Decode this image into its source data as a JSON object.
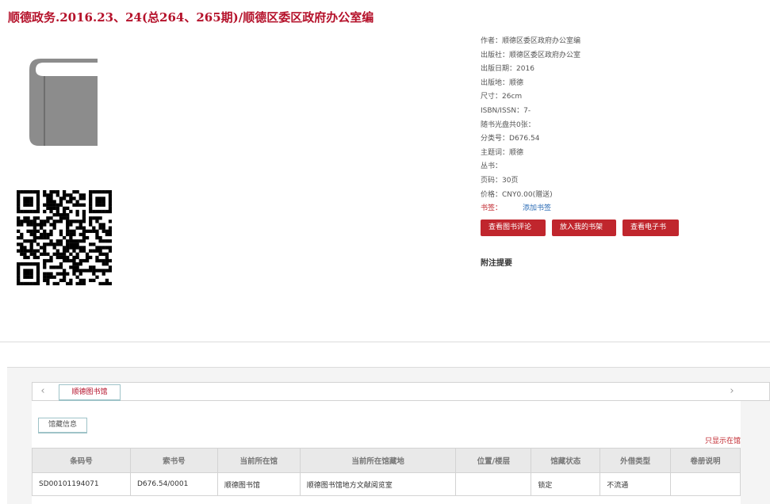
{
  "title": "顺德政务.2016.23、24(总264、265期)/顺德区委区政府办公室编",
  "icons": {
    "cover": "book-cover-icon",
    "qr": "qr-code-icon"
  },
  "meta": [
    {
      "k": "作者：",
      "v": "顺德区委区政府办公室编"
    },
    {
      "k": "出版社：",
      "v": "顺德区委区政府办公室"
    },
    {
      "k": "出版日期：",
      "v": "2016"
    },
    {
      "k": "出版地：",
      "v": "顺德"
    },
    {
      "k": "尺寸：",
      "v": "26cm"
    },
    {
      "k": "ISBN/ISSN：",
      "v": "7-"
    },
    {
      "k": "随书光盘共0张：",
      "v": ""
    },
    {
      "k": "分类号：",
      "v": "D676.54"
    },
    {
      "k": "主题词：",
      "v": "顺德"
    },
    {
      "k": "丛书：",
      "v": ""
    },
    {
      "k": "页码：",
      "v": "30页"
    },
    {
      "k": "价格：",
      "v": "CNY0.00(赠送)"
    }
  ],
  "bookmark": {
    "label": "书签：",
    "add": "添加书签"
  },
  "buttons": {
    "review": "查看图书评论",
    "shelf": "放入我的书架",
    "ebook": "查看电子书"
  },
  "notes_title": "附注提要",
  "holdings": {
    "nav_left": "‹",
    "nav_right": "›",
    "library_tab": "顺德图书馆",
    "info_tab": "馆藏信息",
    "only_link": "只显示在馆",
    "columns": [
      "条码号",
      "索书号",
      "当前所在馆",
      "当前所在馆藏地",
      "位置/楼层",
      "馆藏状态",
      "外借类型",
      "卷册说明"
    ],
    "rows": [
      [
        "SD00101194071",
        "D676.54/0001",
        "顺德图书馆",
        "顺德图书馆地方文献阅览室",
        "",
        "锁定",
        "不流通",
        ""
      ]
    ]
  },
  "colors": {
    "accent": "#c0262d",
    "title": "#b5122b",
    "link": "#2a6bb5"
  }
}
